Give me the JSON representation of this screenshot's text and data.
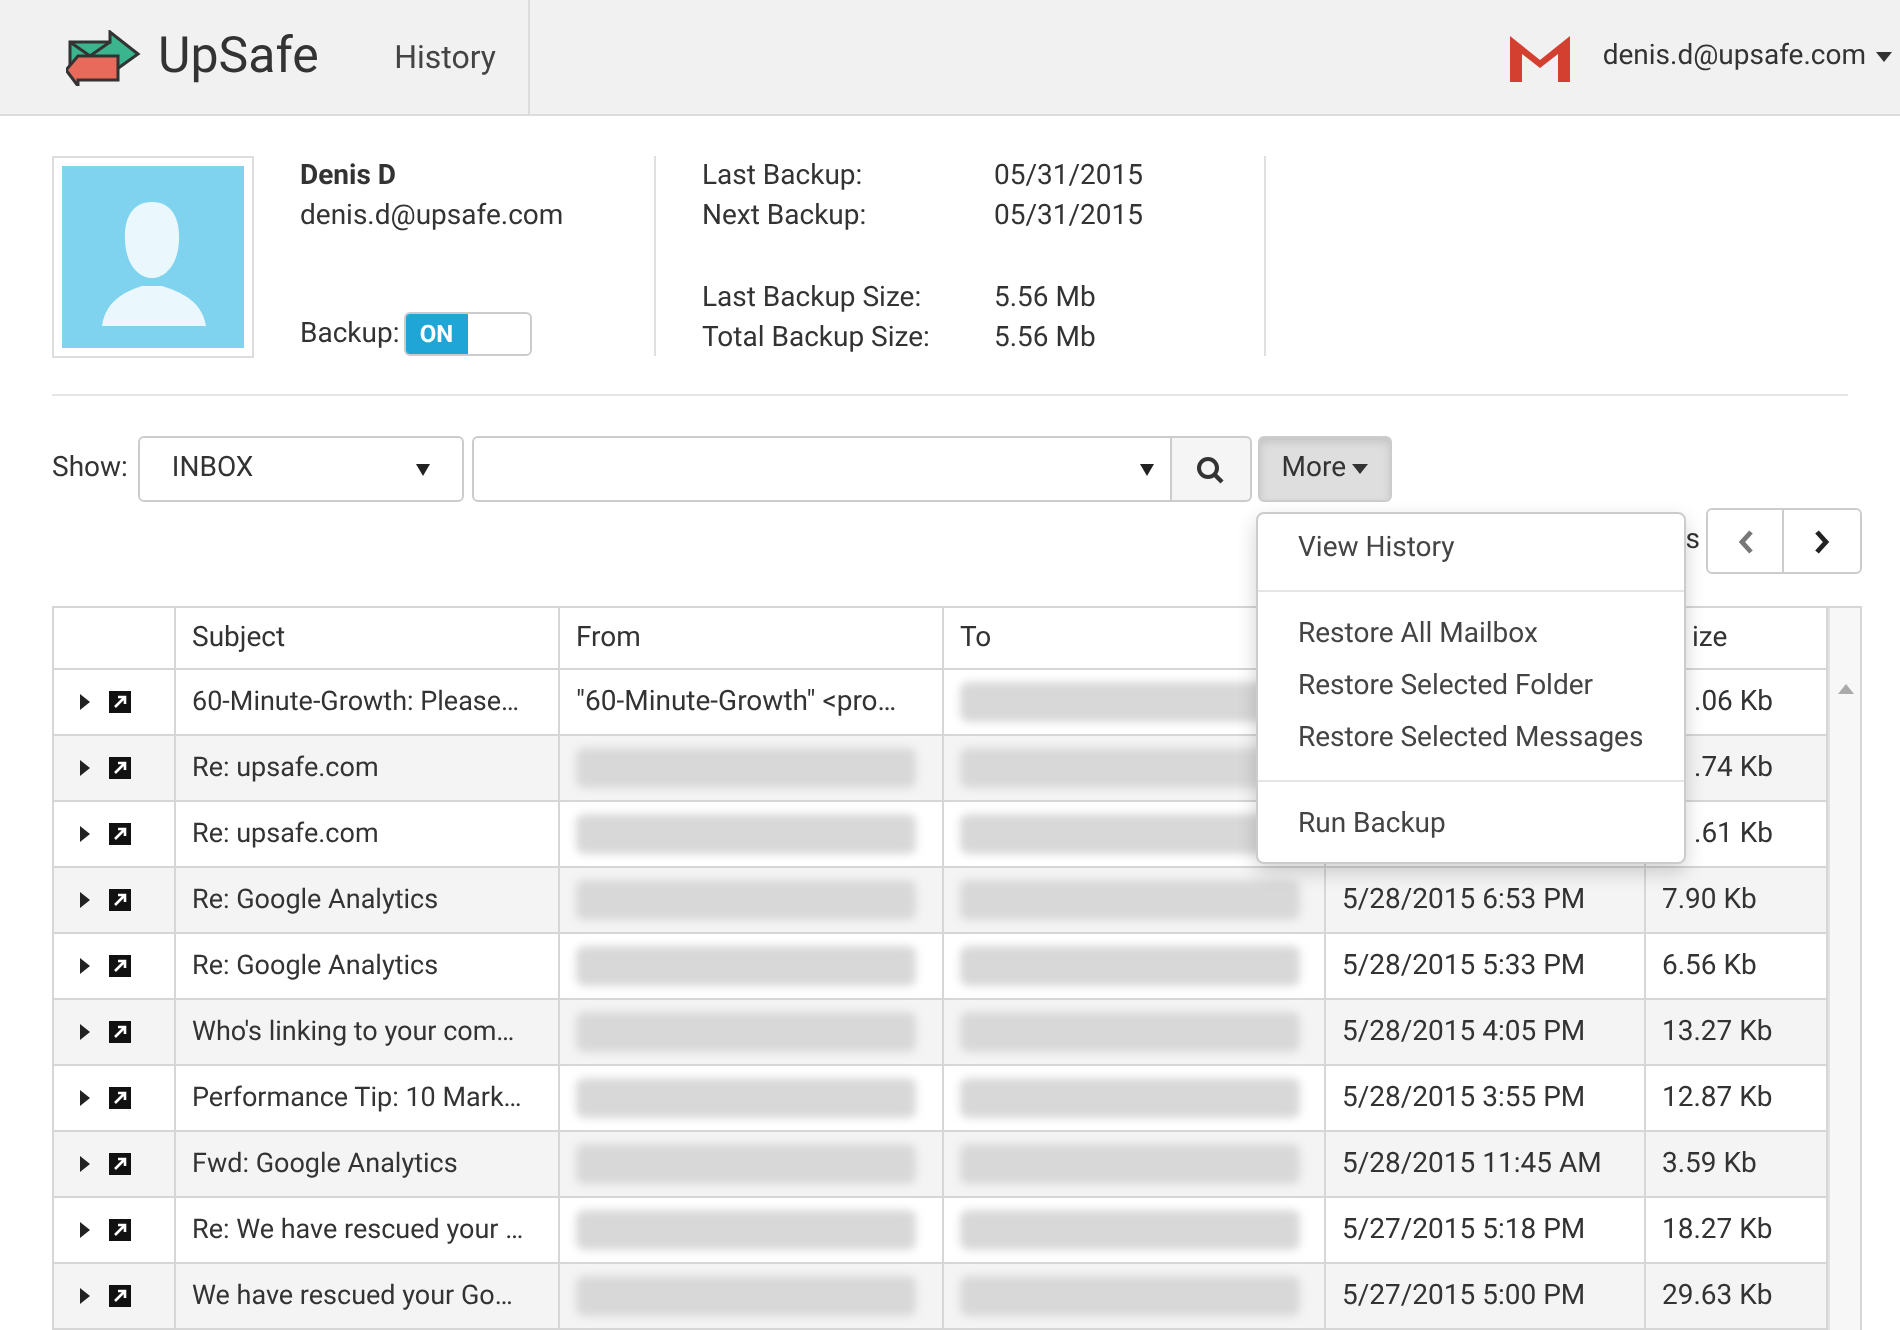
{
  "header": {
    "brand": "UpSafe",
    "nav": [
      {
        "label": "History",
        "selected": false
      }
    ],
    "account": "denis.d@upsafe.com"
  },
  "profile": {
    "name": "Denis D",
    "email": "denis.d@upsafe.com",
    "backup_label": "Backup:",
    "backup_toggle": {
      "label": "ON",
      "on": true
    },
    "stats": [
      {
        "label": "Last Backup:",
        "value": "05/31/2015"
      },
      {
        "label": "Next Backup:",
        "value": "05/31/2015"
      },
      {
        "label": "Last Backup Size:",
        "value": "5.56 Mb"
      },
      {
        "label": "Total Backup Size:",
        "value": "5.56 Mb"
      }
    ]
  },
  "toolbar": {
    "show_label": "Show:",
    "folder": "INBOX",
    "more": "More"
  },
  "more_menu": {
    "groups": [
      [
        "View History"
      ],
      [
        "Restore All Mailbox",
        "Restore Selected Folder",
        "Restore Selected Messages"
      ],
      [
        "Run Backup"
      ]
    ]
  },
  "pager": {
    "label_tail": "s"
  },
  "table": {
    "columns": [
      "Subject",
      "From",
      "To",
      "ize"
    ],
    "rows": [
      {
        "subject": "60-Minute-Growth: Please…",
        "from": {
          "kind": "text",
          "text": "\"60-Minute-Growth\" <pro…"
        },
        "to": {
          "kind": "blurred"
        },
        "size": ".06 Kb"
      },
      {
        "subject": "Re: upsafe.com",
        "from": {
          "kind": "blurred"
        },
        "to": {
          "kind": "blurred"
        },
        "size": ".74 Kb"
      },
      {
        "subject": "Re: upsafe.com",
        "from": {
          "kind": "blurred"
        },
        "to": {
          "kind": "blurred"
        },
        "size": ".61 Kb"
      },
      {
        "subject": "Re: Google Analytics",
        "from": {
          "kind": "blurred"
        },
        "to": {
          "kind": "blurred"
        },
        "date": "5/28/2015 6:53 PM",
        "size": "7.90 Kb"
      },
      {
        "subject": "Re: Google Analytics",
        "from": {
          "kind": "blurred"
        },
        "to": {
          "kind": "blurred"
        },
        "date": "5/28/2015 5:33 PM",
        "size": "6.56 Kb"
      },
      {
        "subject": "Who's linking to your com…",
        "from": {
          "kind": "blurred"
        },
        "to": {
          "kind": "blurred"
        },
        "date": "5/28/2015 4:05 PM",
        "size": "13.27 Kb"
      },
      {
        "subject": "Performance Tip: 10 Mark…",
        "from": {
          "kind": "blurred"
        },
        "to": {
          "kind": "blurred"
        },
        "date": "5/28/2015 3:55 PM",
        "size": "12.87 Kb"
      },
      {
        "subject": "Fwd: Google Analytics",
        "from": {
          "kind": "blurred"
        },
        "to": {
          "kind": "blurred"
        },
        "date": "5/28/2015 11:45 AM",
        "size": "3.59 Kb"
      },
      {
        "subject": "Re: We have rescued your …",
        "from": {
          "kind": "blurred"
        },
        "to": {
          "kind": "blurred"
        },
        "date": "5/27/2015 5:18 PM",
        "size": "18.27 Kb"
      },
      {
        "subject": "We have rescued your Go…",
        "from": {
          "kind": "blurred"
        },
        "to": {
          "kind": "blurred"
        },
        "date": "5/27/2015 5:00 PM",
        "size": "29.63 Kb"
      }
    ]
  }
}
